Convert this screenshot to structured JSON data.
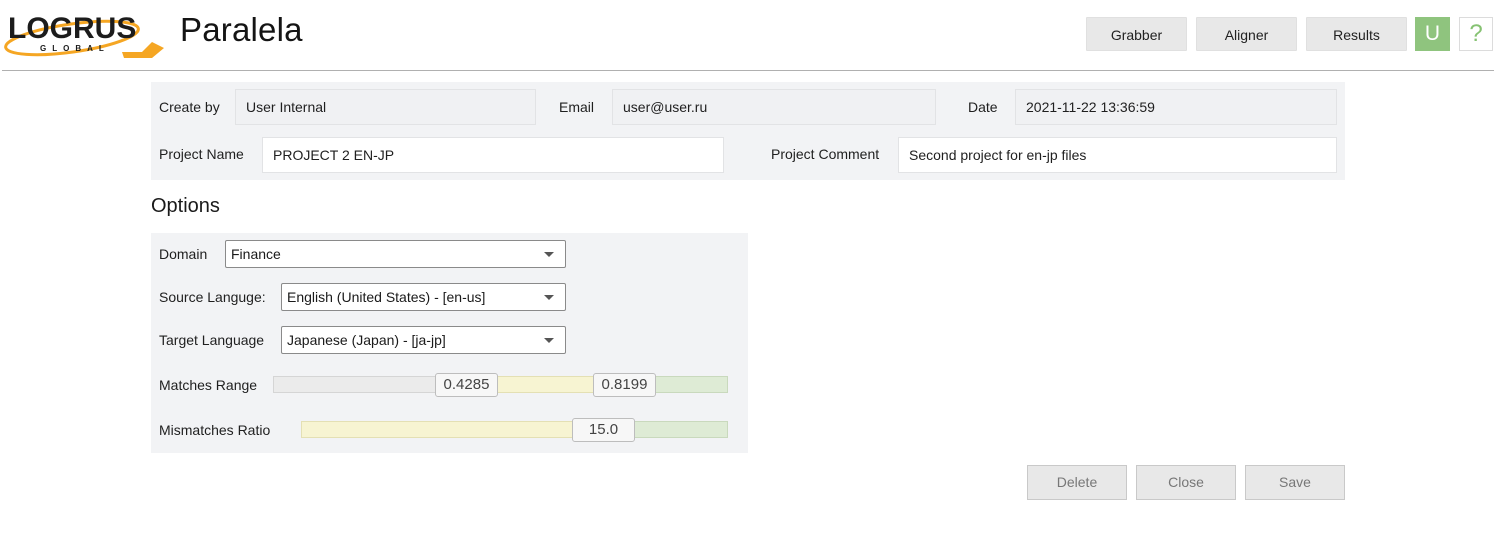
{
  "header": {
    "logo_text": "LOGRUS",
    "logo_subtext": "GLOBAL",
    "app_title": "Paralela",
    "nav": [
      "Grabber",
      "Aligner",
      "Results"
    ],
    "avatar_letter": "U",
    "help_symbol": "?"
  },
  "project": {
    "create_by_label": "Create by",
    "create_by_value": "User Internal",
    "email_label": "Email",
    "email_value": "user@user.ru",
    "date_label": "Date",
    "date_value": "2021-11-22 13:36:59",
    "project_name_label": "Project Name",
    "project_name_value": "PROJECT 2 EN-JP",
    "project_comment_label": "Project Comment",
    "project_comment_value": "Second project for en-jp files"
  },
  "options": {
    "title": "Options",
    "domain_label": "Domain",
    "domain_value": "Finance",
    "source_label": "Source Languge:",
    "source_value": "English (United States) - [en-us]",
    "target_label": "Target Language",
    "target_value": "Japanese (Japan) - [ja-jp]",
    "matches_label": "Matches Range",
    "matches_low": "0.4285",
    "matches_high": "0.8199",
    "mismatches_label": "Mismatches Ratio",
    "mismatches_value": "15.0"
  },
  "actions": {
    "delete": "Delete",
    "close": "Close",
    "save": "Save"
  },
  "colors": {
    "avatar": "#8fc47e",
    "help": "#86c272",
    "logo_orange": "#f5a623"
  }
}
